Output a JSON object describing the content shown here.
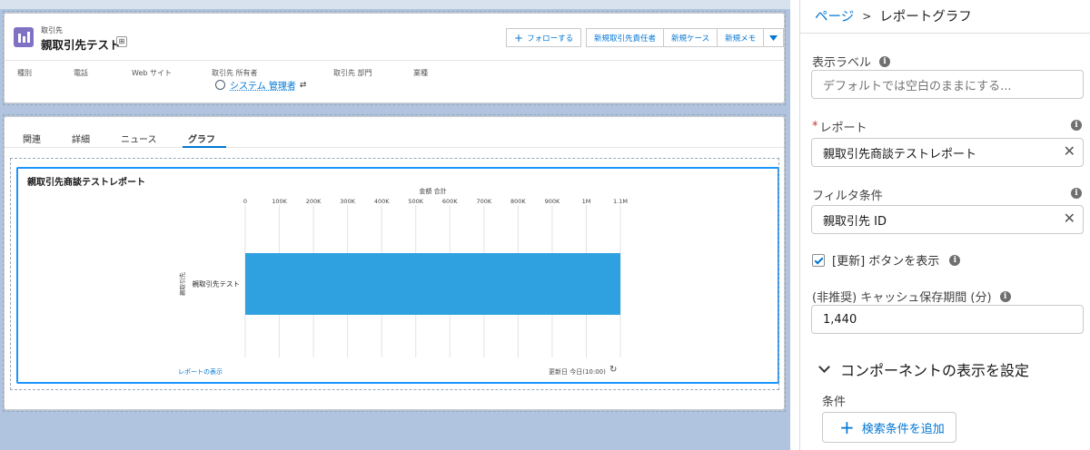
{
  "record": {
    "object_type": "取引先",
    "name": "親取引先テスト",
    "actions": {
      "follow": "フォローする",
      "new_contact": "新規取引先責任者",
      "new_case": "新規ケース",
      "new_note": "新規メモ"
    },
    "fields": {
      "type": "種別",
      "phone": "電話",
      "website": "Web サイト",
      "owner": "取引先 所有者",
      "division": "取引先 部門",
      "industry": "業種"
    },
    "owner_name": "システム 管理者"
  },
  "tabs": {
    "related": "関連",
    "details": "詳細",
    "news": "ニュース",
    "graph": "グラフ",
    "active": "グラフ"
  },
  "report_card": {
    "title": "親取引先商談テストレポート",
    "footer_link": "レポートの表示",
    "footer_timestamp": "更新日 今日(10:00)"
  },
  "chart_data": {
    "type": "bar",
    "orientation": "horizontal",
    "title": "",
    "xlabel": "金額 合計",
    "ylabel": "親取引先",
    "categories": [
      "親取引先テスト"
    ],
    "values": [
      1100000
    ],
    "xlim": [
      0,
      1100000
    ],
    "x_ticks": [
      0,
      100000,
      200000,
      300000,
      400000,
      500000,
      600000,
      700000,
      800000,
      900000,
      1000000,
      1100000
    ],
    "x_tick_labels": [
      "0",
      "100K",
      "200K",
      "300K",
      "400K",
      "500K",
      "600K",
      "700K",
      "800K",
      "900K",
      "1M",
      "1.1M"
    ],
    "bar_color": "#2fa0e0",
    "grid": true
  },
  "panel": {
    "breadcrumb": [
      "ページ",
      "レポートグラフ"
    ],
    "label_field": {
      "label": "表示ラベル",
      "placeholder": "デフォルトでは空白のままにする..."
    },
    "report_field": {
      "label": "レポート",
      "value": "親取引先商談テストレポート"
    },
    "filter_field": {
      "label": "フィルタ条件",
      "value": "親取引先 ID"
    },
    "refresh_checkbox": {
      "label": "[更新] ボタンを表示",
      "checked": true
    },
    "cache_field": {
      "label": "(非推奨) キャッシュ保存期間 (分)",
      "value": "1,440"
    },
    "visibility_section": "コンポーネントの表示を設定",
    "conditions_label": "条件",
    "add_condition_button": "検索条件を追加"
  },
  "colors": {
    "brand": "#0176d3",
    "canvas_bg": "#b0c4df",
    "account_icon": "#7f72c4"
  }
}
